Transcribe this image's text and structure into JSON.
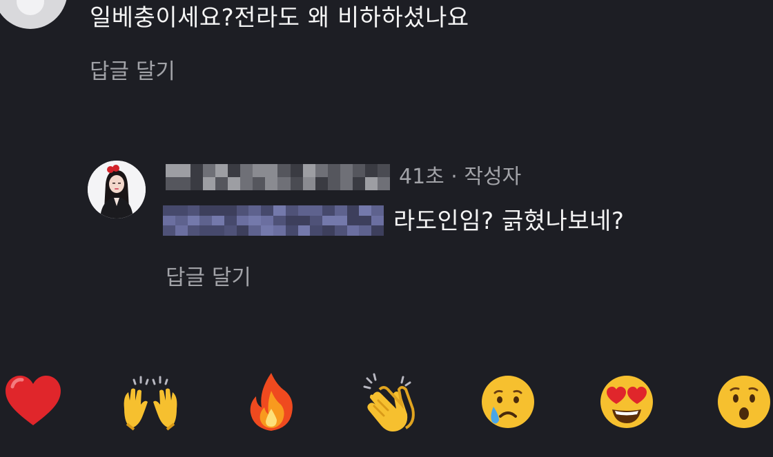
{
  "top_comment": {
    "text": "일베충이세요?전라도 왜 비하하셨나요",
    "reply_label": "답글 달기"
  },
  "reply_comment": {
    "meta": "41초 · 작성자",
    "text": "라도인임? 긁혔나보네?",
    "reply_label": "답글 달기"
  },
  "reactions": [
    {
      "icon": "red-heart-icon"
    },
    {
      "icon": "raising-hands-icon"
    },
    {
      "icon": "fire-icon"
    },
    {
      "icon": "clapping-hands-icon"
    },
    {
      "icon": "crying-face-icon"
    },
    {
      "icon": "heart-eyes-face-icon"
    },
    {
      "icon": "surprised-face-icon"
    }
  ],
  "colors": {
    "background": "#1d1e24",
    "primary_text": "#f4f4f4",
    "secondary_text": "#a2a3a8"
  }
}
